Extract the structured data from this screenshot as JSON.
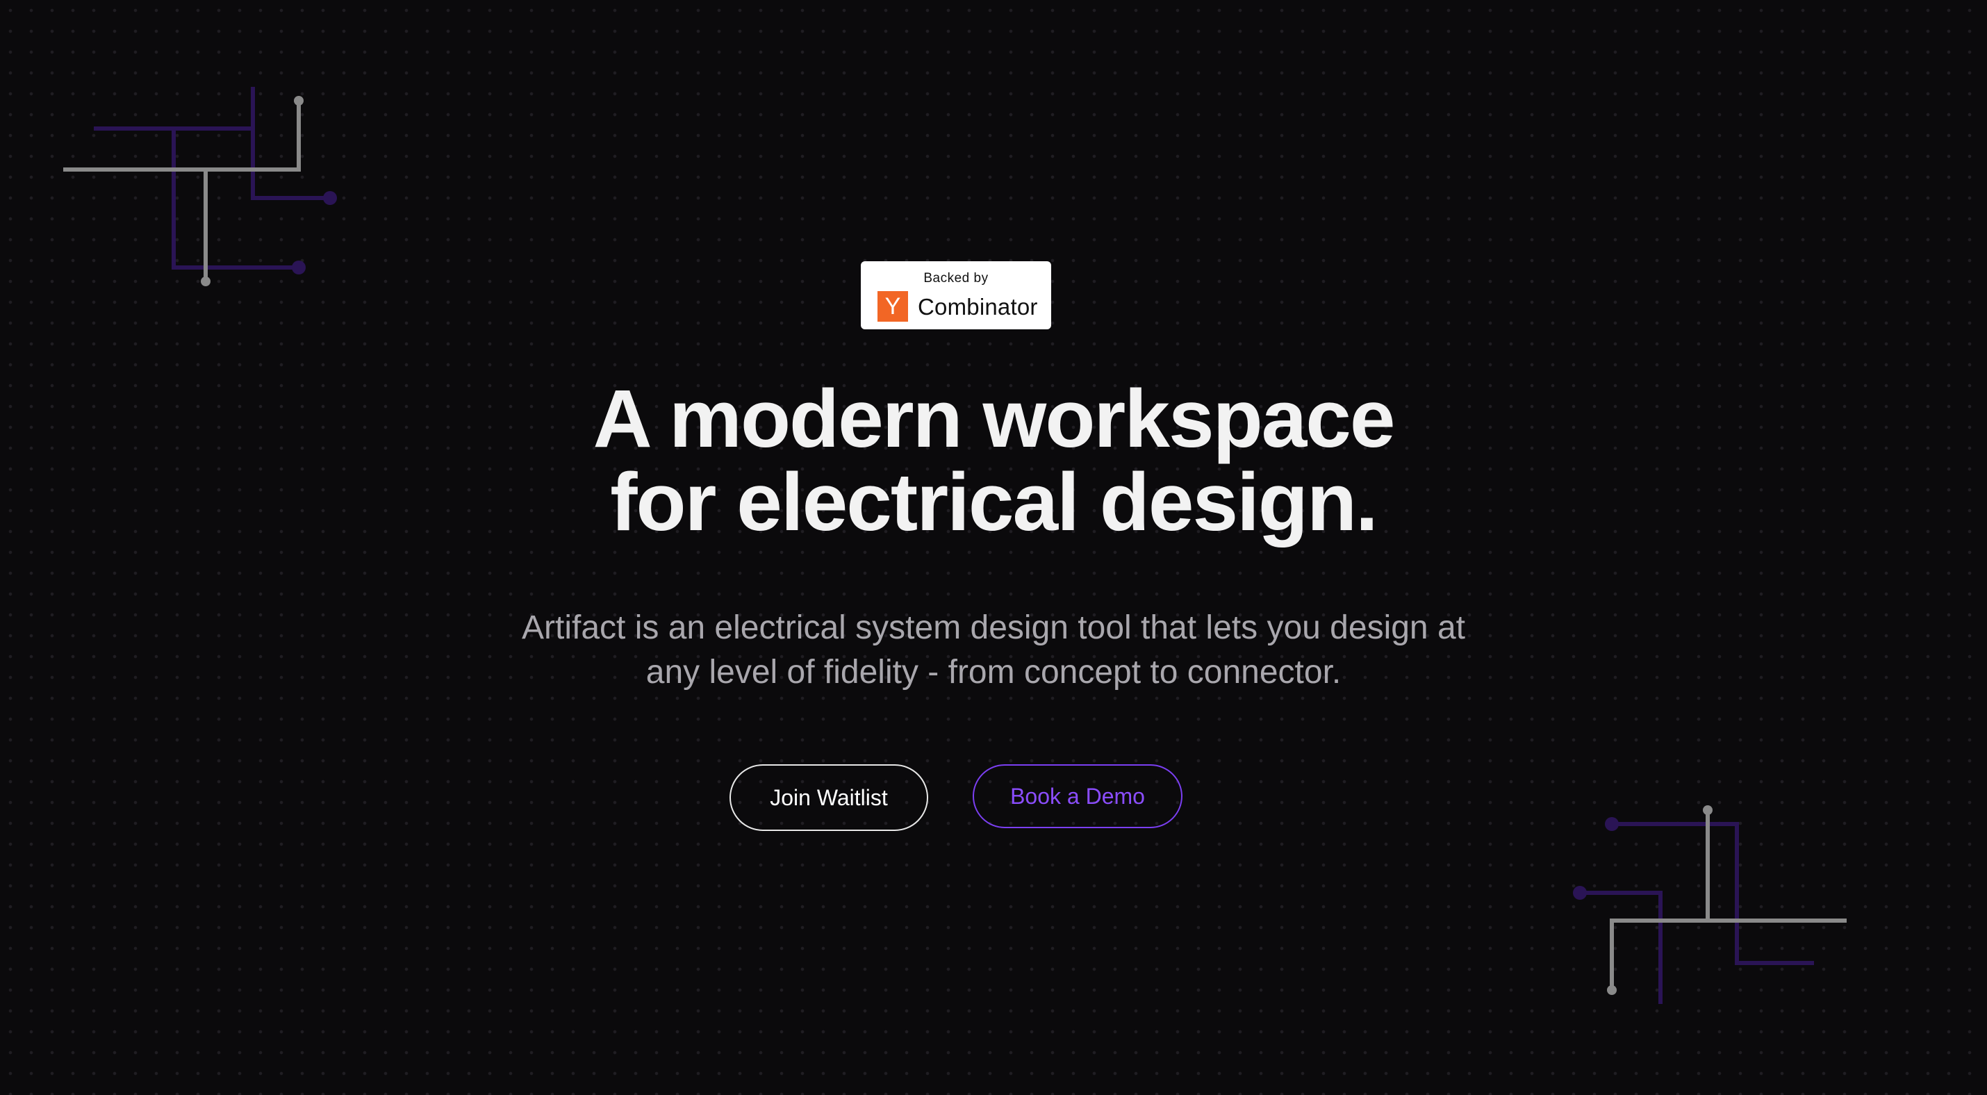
{
  "badge": {
    "backed_by": "Backed by",
    "logo_letter": "Y",
    "name": "Combinator"
  },
  "hero": {
    "headline_line1": "A modern workspace",
    "headline_line2": "for electrical design.",
    "subtitle_line1": "Artifact is an electrical system design tool that lets you design at",
    "subtitle_line2": "any level of fidelity - from concept to connector."
  },
  "actions": {
    "join_waitlist": "Join Waitlist",
    "book_demo": "Book a Demo"
  },
  "colors": {
    "background": "#0b0a0c",
    "accent_purple": "#7b3ff2",
    "yc_orange": "#f26625",
    "circuit_grey": "#8a8a8a",
    "circuit_purple": "#2a1455"
  },
  "decorations": [
    "circuit-trace-top-left",
    "circuit-trace-bottom-right"
  ]
}
